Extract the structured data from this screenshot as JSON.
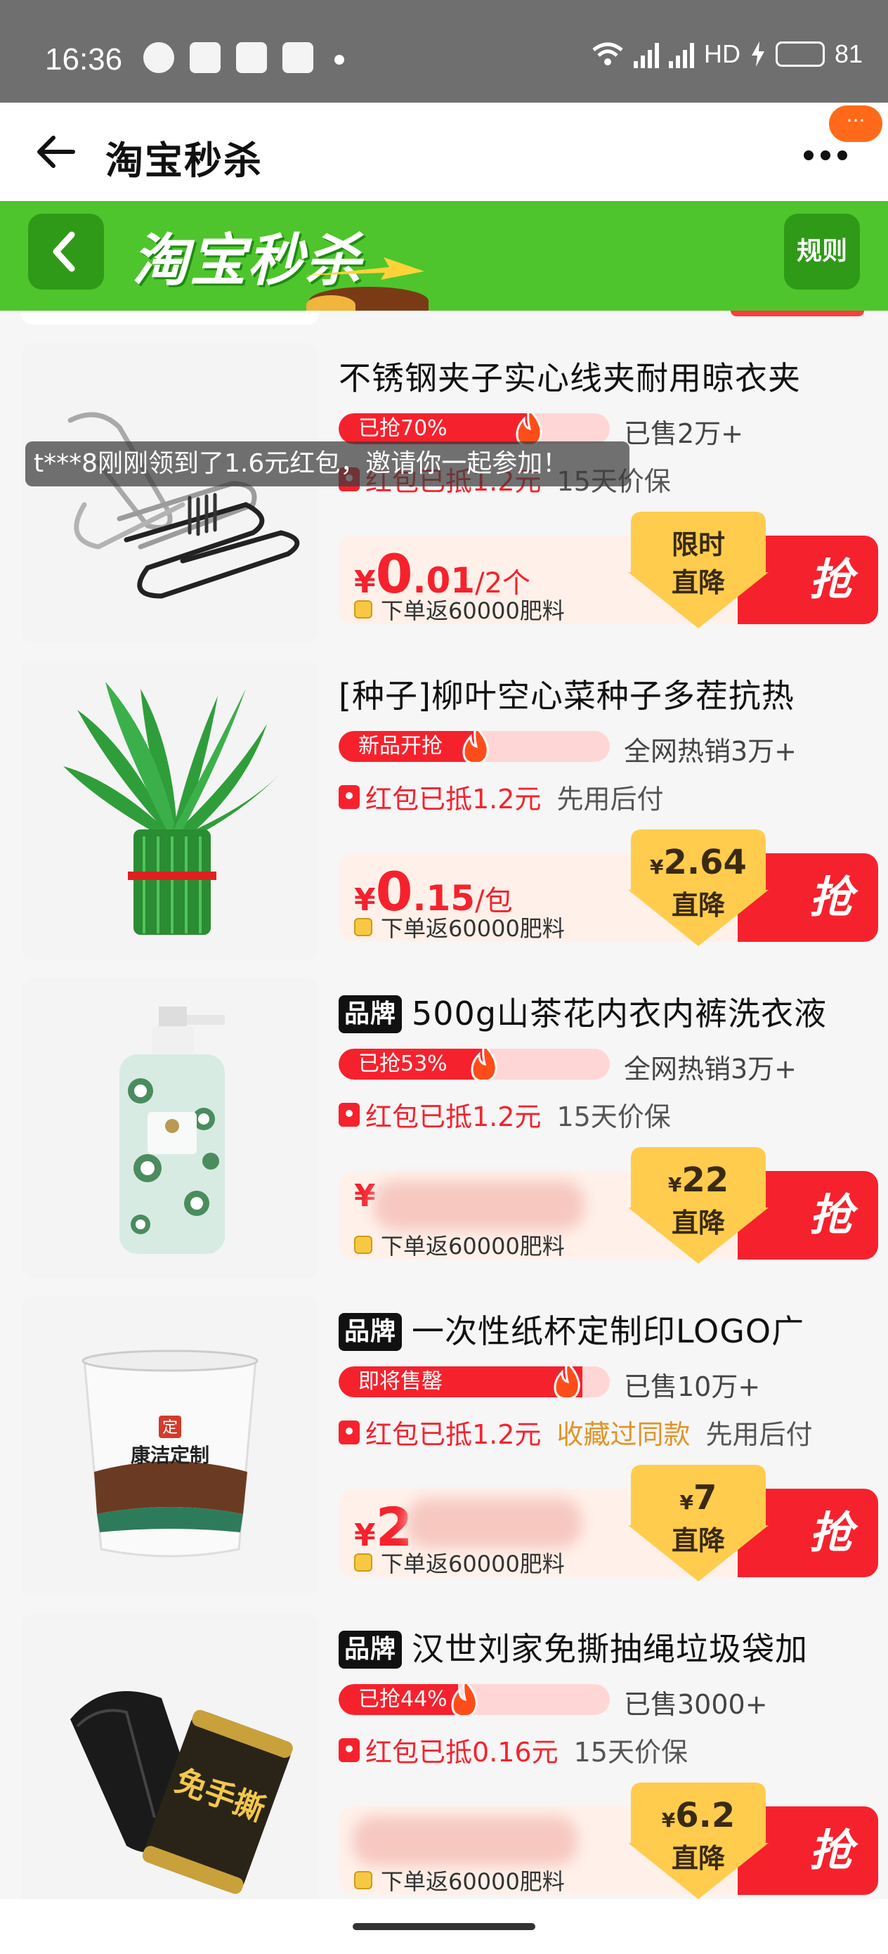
{
  "status_bar": {
    "time": "16:36",
    "battery": "81",
    "network": "HD",
    "battery_level": 0.81
  },
  "titlebar": {
    "title": "淘宝秒杀",
    "more_label": "···"
  },
  "banner": {
    "logo_text": "淘宝秒杀",
    "rules_label": "规则"
  },
  "toast": "t***8刚刚领到了1.6元红包，邀请你一起参加！",
  "products": [
    {
      "brand": "",
      "title": "不锈钢夹子实心线夹耐用晾衣夹",
      "progress_label": "已抢70%",
      "progress": 0.7,
      "sold": "已售2万+",
      "coupon": "红包已抵1.2元",
      "tag_orange": "",
      "tag_gray": "15天价保",
      "price_currency": "¥",
      "price_int": "0",
      "price_dec": ".01",
      "price_unit": "/2个",
      "refund": "下单返60000肥料",
      "drop_line1": "限时",
      "drop_yen": "",
      "drop_line2": "直降",
      "grab": "抢"
    },
    {
      "brand": "",
      "title": "[种子]柳叶空心菜种子多茬抗热",
      "progress_label": "新品开抢",
      "progress": 0.5,
      "sold": "全网热销3万+",
      "coupon": "红包已抵1.2元",
      "tag_orange": "",
      "tag_gray": "先用后付",
      "price_currency": "¥",
      "price_int": "0",
      "price_dec": ".15",
      "price_unit": "/包",
      "refund": "下单返60000肥料",
      "drop_line1": "2.64",
      "drop_yen": "¥",
      "drop_line2": "直降",
      "grab": "抢"
    },
    {
      "brand": "品牌",
      "title": "500g山茶花内衣内裤洗衣液",
      "progress_label": "已抢53%",
      "progress": 0.53,
      "sold": "全网热销3万+",
      "coupon": "红包已抵1.2元",
      "tag_orange": "",
      "tag_gray": "15天价保",
      "price_currency": "¥",
      "price_int": "",
      "price_dec": "",
      "price_unit": "",
      "refund": "下单返60000肥料",
      "drop_line1": "22",
      "drop_yen": "¥",
      "drop_line2": "直降",
      "grab": "抢"
    },
    {
      "brand": "品牌",
      "title": "一次性纸杯定制印LOGO广",
      "progress_label": "即将售罄",
      "progress": 0.9,
      "sold": "已售10万+",
      "coupon": "红包已抵1.2元",
      "tag_orange": "收藏过同款",
      "tag_gray": "先用后付",
      "price_currency": "¥",
      "price_int": "2",
      "price_dec": "",
      "price_unit": "",
      "refund": "下单返60000肥料",
      "drop_line1": "7",
      "drop_yen": "¥",
      "drop_line2": "直降",
      "grab": "抢"
    },
    {
      "brand": "品牌",
      "title": "汉世刘家免撕抽绳垃圾袋加",
      "progress_label": "已抢44%",
      "progress": 0.44,
      "sold": "已售3000+",
      "coupon": "红包已抵0.16元",
      "tag_orange": "",
      "tag_gray": "15天价保",
      "price_currency": "",
      "price_int": "",
      "price_dec": "",
      "price_unit": "",
      "refund": "下单返60000肥料",
      "drop_line1": "6.2",
      "drop_yen": "¥",
      "drop_line2": "直降",
      "grab": "抢"
    }
  ],
  "image_text": {
    "cup_brand": "康洁定制",
    "cup_badge": "定",
    "bag_text": "免手撕"
  },
  "colors": {
    "accent_red": "#f5222d",
    "banner_green": "#4ec52c",
    "status_gray": "#6f6f6f"
  }
}
